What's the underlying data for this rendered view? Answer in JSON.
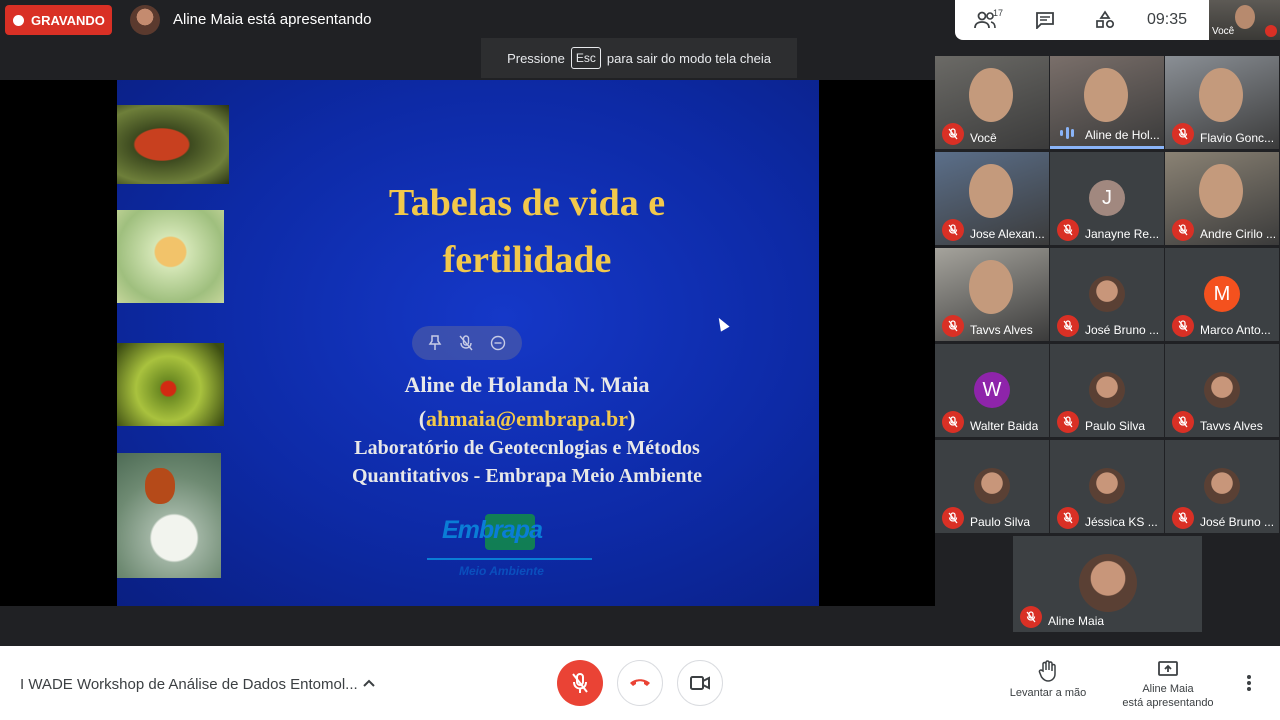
{
  "top": {
    "recording_label": "GRAVANDO",
    "presenting_label": "Aline Maia está apresentando",
    "esc_toast": {
      "prefix": "Pressione",
      "key": "Esc",
      "suffix": "para sair do modo tela cheia"
    },
    "people_count": "17",
    "clock": "09:35",
    "self_label": "Você"
  },
  "slide": {
    "title_line1": "Tabelas de vida e",
    "title_line2": "fertilidade",
    "author": "Aline de Holanda N. Maia",
    "email_open": "(",
    "email": "ahmaia@embrapa.br",
    "email_close": ")",
    "lab_line1": "Laboratório de Geotecnlogias e Métodos",
    "lab_line2": "Quantitativos - Embrapa Meio Ambiente",
    "logo_word": "Embrapa",
    "logo_sub": "Meio Ambiente"
  },
  "participants": [
    {
      "name": "Você",
      "kind": "video",
      "muted": true
    },
    {
      "name": "Aline de Hol...",
      "kind": "video",
      "muted": false,
      "speaking": true
    },
    {
      "name": "Flavio Gonc...",
      "kind": "video",
      "muted": true
    },
    {
      "name": "Jose Alexan...",
      "kind": "video",
      "muted": true
    },
    {
      "name": "Janayne Re...",
      "kind": "initial",
      "initial": "J",
      "color": "#a1887f",
      "muted": true
    },
    {
      "name": "Andre Cirilo ...",
      "kind": "video",
      "muted": true
    },
    {
      "name": "Tavvs Alves",
      "kind": "video",
      "muted": true
    },
    {
      "name": "José Bruno ...",
      "kind": "avatar",
      "muted": true
    },
    {
      "name": "Marco Anto...",
      "kind": "initial",
      "initial": "M",
      "color": "#f4511e",
      "muted": true
    },
    {
      "name": "Walter Baida",
      "kind": "initial",
      "initial": "W",
      "color": "#8e24aa",
      "muted": true
    },
    {
      "name": "Paulo Silva",
      "kind": "avatar",
      "muted": true
    },
    {
      "name": "Tavvs Alves",
      "kind": "avatar",
      "muted": true
    },
    {
      "name": "Paulo Silva",
      "kind": "avatar",
      "muted": true
    },
    {
      "name": "Jéssica KS ...",
      "kind": "avatar",
      "muted": true
    },
    {
      "name": "José Bruno ...",
      "kind": "avatar",
      "muted": true
    },
    {
      "name": "Aline Maia",
      "kind": "avatar",
      "muted": true
    }
  ],
  "bottom": {
    "meeting_title": "I WADE Workshop de Análise de Dados Entomol...",
    "raise_hand": "Levantar a mão",
    "presenter_line1": "Aline Maia",
    "presenter_line2": "está apresentando"
  },
  "colors": {
    "accent_red": "#d93025",
    "slide_title": "#f2c84b",
    "slide_bg": "#0d2aa6",
    "speaking": "#8ab4f8"
  }
}
